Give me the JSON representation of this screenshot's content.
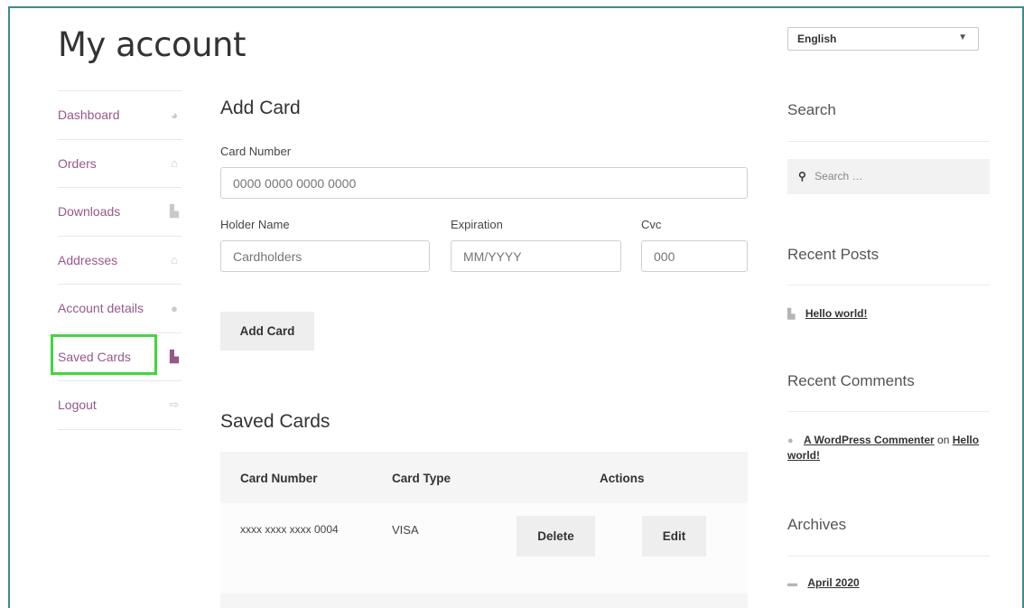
{
  "page": {
    "title": "My account"
  },
  "nav": {
    "items": [
      {
        "label": "Dashboard",
        "icon": "dashboard-icon"
      },
      {
        "label": "Orders",
        "icon": "basket-icon"
      },
      {
        "label": "Downloads",
        "icon": "file-icon"
      },
      {
        "label": "Addresses",
        "icon": "home-icon"
      },
      {
        "label": "Account details",
        "icon": "user-icon"
      },
      {
        "label": "Saved Cards",
        "icon": "file-icon",
        "active": true
      },
      {
        "label": "Logout",
        "icon": "sign-out-icon"
      }
    ]
  },
  "add_card": {
    "heading": "Add Card",
    "card_number_label": "Card Number",
    "card_number_placeholder": "0000 0000 0000 0000",
    "holder_label": "Holder Name",
    "holder_placeholder": "Cardholders",
    "expiration_label": "Expiration",
    "expiration_placeholder": "MM/YYYY",
    "cvc_label": "Cvc",
    "cvc_placeholder": "000",
    "submit_label": "Add Card"
  },
  "saved_cards": {
    "heading": "Saved Cards",
    "columns": [
      "Card Number",
      "Card Type",
      "Actions"
    ],
    "rows": [
      {
        "number": "xxxx xxxx xxxx 0004",
        "type": "VISA",
        "delete_label": "Delete",
        "edit_label": "Edit"
      }
    ]
  },
  "sidebar": {
    "language": "English",
    "search_title": "Search",
    "search_placeholder": "Search …",
    "recent_posts_title": "Recent Posts",
    "recent_posts": [
      "Hello world!"
    ],
    "recent_comments_title": "Recent Comments",
    "comment": {
      "author": "A WordPress Commenter",
      "on": "on",
      "post": "Hello world!"
    },
    "archives_title": "Archives",
    "archives": [
      "April 2020"
    ]
  },
  "colors": {
    "accent": "#96588a",
    "highlight": "#3fd83c",
    "frame": "#3a8f89"
  }
}
